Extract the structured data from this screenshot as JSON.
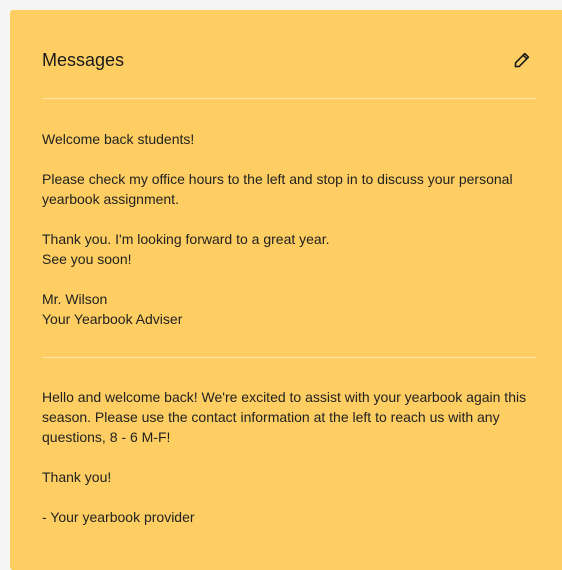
{
  "panel": {
    "title": "Messages",
    "edit_icon": "pencil-icon",
    "background_color": "#fece62"
  },
  "messages": [
    {
      "paragraphs": [
        "Welcome back students!",
        "Please check my office hours to the left and stop in to discuss your personal yearbook assignment.",
        "Thank you. I'm looking forward to a great year.\nSee you soon!",
        "Mr. Wilson\nYour Yearbook Adviser"
      ]
    },
    {
      "paragraphs": [
        "Hello and welcome back! We're excited to assist with your yearbook again this season. Please use the contact information at the left to reach us with any questions, 8 - 6 M-F!",
        "Thank you!",
        "- Your yearbook provider"
      ]
    }
  ]
}
